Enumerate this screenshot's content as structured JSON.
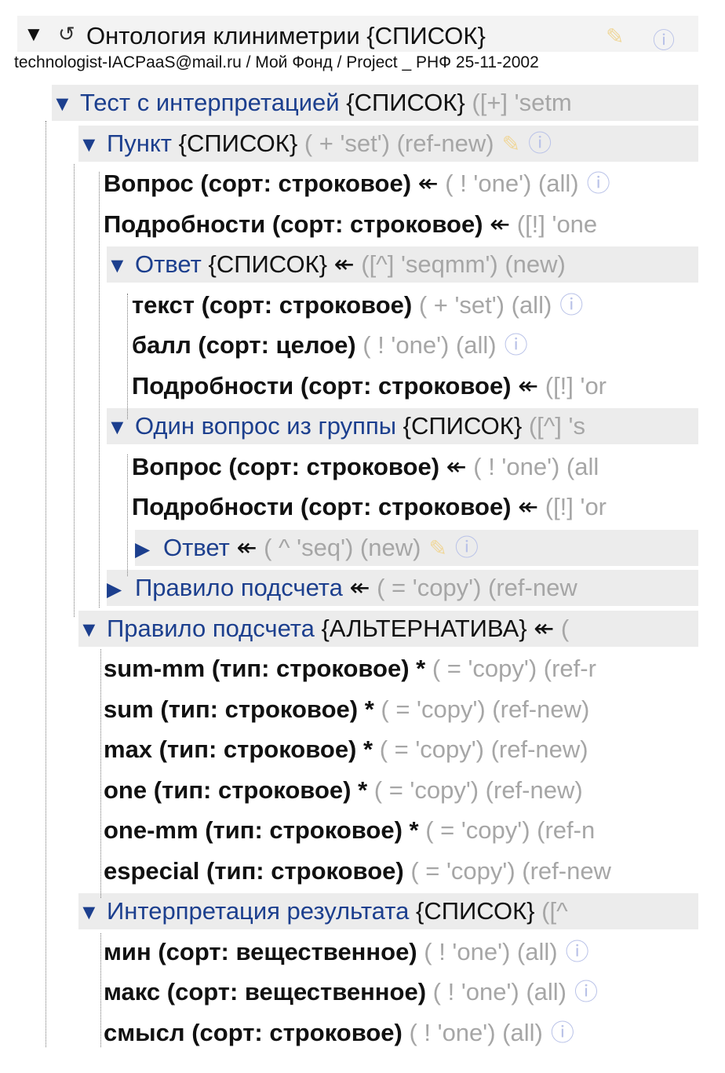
{
  "header": {
    "collapse_icon": "triangle-down-icon",
    "reload_icon": "reload-icon",
    "title": "Онтология клиниметрии {СПИСОК}",
    "edit_icon": "pencil-icon",
    "info_icon": "info-icon"
  },
  "breadcrumb": "technologist-IACPaaS@mail.ru / Мой Фонд / Project _ РНФ 25-11-2002",
  "items": [
    {
      "kind": "node",
      "expanded": true,
      "name": "Тест с интерпретацией",
      "type": "{СПИСОК}",
      "ref": "",
      "meta": "([+] 'setm",
      "icons": []
    },
    {
      "kind": "node",
      "expanded": true,
      "name": "Пункт",
      "type": "{СПИСОК}",
      "ref": "",
      "meta": "( + 'set') (ref-new)",
      "icons": [
        "edit",
        "info"
      ]
    },
    {
      "kind": "leaf",
      "name": "Вопрос",
      "type": "(сорт: строковое)",
      "ref": "↞",
      "meta": "( ! 'one') (all)",
      "icons": [
        "info"
      ]
    },
    {
      "kind": "leaf",
      "name": "Подробности",
      "type": "(сорт: строковое)",
      "ref": "↞",
      "meta": "([!] 'one",
      "icons": []
    },
    {
      "kind": "node",
      "expanded": true,
      "name": "Ответ",
      "type": "{СПИСОК}",
      "ref": "↞",
      "meta": "([^] 'seqmm') (new)",
      "icons": []
    },
    {
      "kind": "leaf",
      "name": "текст",
      "type": "(сорт: строковое)",
      "ref": "",
      "meta": "( + 'set') (all)",
      "icons": [
        "info"
      ]
    },
    {
      "kind": "leaf",
      "name": "балл",
      "type": "(сорт: целое)",
      "ref": "",
      "meta": "( ! 'one') (all)",
      "icons": [
        "info"
      ]
    },
    {
      "kind": "leaf",
      "name": "Подробности",
      "type": "(сорт: строковое)",
      "ref": "↞",
      "meta": "([!] 'or",
      "icons": []
    },
    {
      "kind": "node",
      "expanded": true,
      "name": "Один вопрос из группы",
      "type": "{СПИСОК}",
      "ref": "",
      "meta": "([^] 's",
      "icons": []
    },
    {
      "kind": "leaf",
      "name": "Вопрос",
      "type": "(сорт: строковое)",
      "ref": "↞",
      "meta": "( ! 'one') (all",
      "icons": []
    },
    {
      "kind": "leaf",
      "name": "Подробности",
      "type": "(сорт: строковое)",
      "ref": "↞",
      "meta": "([!] 'or",
      "icons": []
    },
    {
      "kind": "node",
      "expanded": false,
      "name": "Ответ",
      "type": "",
      "ref": "↞",
      "meta": "( ^ 'seq') (new)",
      "icons": [
        "edit",
        "info"
      ]
    },
    {
      "kind": "node",
      "expanded": false,
      "name": "Правило подсчета",
      "type": "",
      "ref": "↞",
      "meta": "( = 'copy') (ref-new",
      "icons": []
    },
    {
      "kind": "node",
      "expanded": true,
      "name": "Правило подсчета",
      "type": "{АЛЬТЕРНАТИВА}",
      "ref": "↞",
      "meta": "(",
      "icons": []
    },
    {
      "kind": "leaf",
      "name": "sum-mm",
      "type": "(тип: строковое) *",
      "ref": "",
      "meta": "( = 'copy') (ref-r",
      "icons": []
    },
    {
      "kind": "leaf",
      "name": "sum",
      "type": "(тип: строковое) *",
      "ref": "",
      "meta": "( = 'copy') (ref-new)",
      "icons": []
    },
    {
      "kind": "leaf",
      "name": "max",
      "type": "(тип: строковое) *",
      "ref": "",
      "meta": "( = 'copy') (ref-new)",
      "icons": []
    },
    {
      "kind": "leaf",
      "name": "one",
      "type": "(тип: строковое) *",
      "ref": "",
      "meta": "( = 'copy') (ref-new)",
      "icons": []
    },
    {
      "kind": "leaf",
      "name": "one-mm",
      "type": "(тип: строковое) *",
      "ref": "",
      "meta": "( = 'copy') (ref-n",
      "icons": []
    },
    {
      "kind": "leaf",
      "name": "especial",
      "type": "(тип: строковое)",
      "ref": "",
      "meta": "( = 'copy') (ref-new",
      "icons": []
    },
    {
      "kind": "node",
      "expanded": true,
      "name": "Интерпретация результата",
      "type": "{СПИСОК}",
      "ref": "",
      "meta": "([^",
      "icons": []
    },
    {
      "kind": "leaf",
      "name": "мин",
      "type": "(сорт: вещественное)",
      "ref": "",
      "meta": "( ! 'one') (all)",
      "icons": [
        "info"
      ]
    },
    {
      "kind": "leaf",
      "name": "макс",
      "type": "(сорт: вещественное)",
      "ref": "",
      "meta": "( ! 'one') (all)",
      "icons": [
        "info"
      ]
    },
    {
      "kind": "leaf",
      "name": "смысл",
      "type": "(сорт: строковое)",
      "ref": "",
      "meta": "( ! 'one') (all)",
      "icons": [
        "info"
      ]
    }
  ],
  "colors": {
    "node": "#1c3f8e",
    "meta": "#a6a6a6",
    "section_bg": "#ececec"
  }
}
